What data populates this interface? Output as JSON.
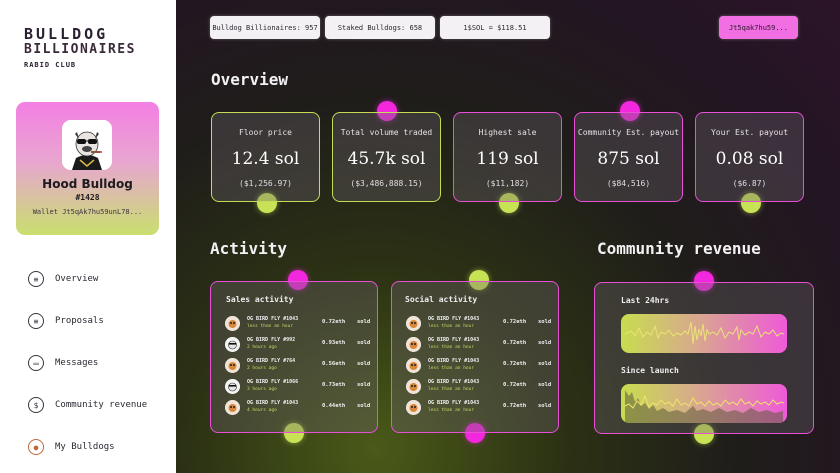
{
  "brand": {
    "line1": "BULLDOG",
    "line2": "BILLIONAIRES",
    "line3": "RABID CLUB"
  },
  "profile": {
    "name": "Hood Bulldog",
    "id": "#1428",
    "wallet": "Wallet Jt5qAk7hu59unL78..."
  },
  "nav": [
    {
      "label": "Overview",
      "icon": "overview-icon",
      "glyph": "≡"
    },
    {
      "label": "Proposals",
      "icon": "proposals-icon",
      "glyph": "≡"
    },
    {
      "label": "Messages",
      "icon": "messages-icon",
      "glyph": "▭"
    },
    {
      "label": "Community revenue",
      "icon": "dollar-icon",
      "glyph": "$"
    },
    {
      "label": "My Bulldogs",
      "icon": "bulldog-icon",
      "glyph": "●"
    }
  ],
  "topbar": {
    "billionaires": "Bulldog Billionaires: 957",
    "staked": "Staked Bulldogs: 658",
    "sol_price": "1$SOL = $118.51",
    "wallet": "Jt5qak7hu59..."
  },
  "overview": {
    "title": "Overview",
    "stats": [
      {
        "label": "Floor price",
        "value": "12.4 sol",
        "usd": "($1,256.97)"
      },
      {
        "label": "Total volume traded",
        "value": "45.7k sol",
        "usd": "($3,486,888.15)"
      },
      {
        "label": "Highest sale",
        "value": "119 sol",
        "usd": "($11,182)"
      },
      {
        "label": "Community Est. payout",
        "value": "875 sol",
        "usd": "($84,516)"
      },
      {
        "label": "Your Est. payout",
        "value": "0.08 sol",
        "usd": "($6.87)"
      }
    ]
  },
  "activity": {
    "title": "Activity",
    "sales": {
      "title": "Sales activity",
      "rows": [
        {
          "name": "OG BIRD FLY #1043",
          "time": "less than an hour",
          "price": "0.72eth",
          "status": "sold"
        },
        {
          "name": "OG BIRD FLY #992",
          "time": "2 hours ago",
          "price": "0.93eth",
          "status": "sold"
        },
        {
          "name": "OG BIRD FLY #764",
          "time": "2 hours ago",
          "price": "0.56eth",
          "status": "sold"
        },
        {
          "name": "OG BIRD FLY #1066",
          "time": "3 hours ago",
          "price": "0.73eth",
          "status": "sold"
        },
        {
          "name": "OG BIRD FLY #1043",
          "time": "4 hours ago",
          "price": "0.44eth",
          "status": "sold"
        }
      ]
    },
    "social": {
      "title": "Social activity",
      "rows": [
        {
          "name": "OG BIRD FLY #1043",
          "time": "less than an hour",
          "price": "0.72eth",
          "status": "sold"
        },
        {
          "name": "OG BIRD FLY #1043",
          "time": "less than an hour",
          "price": "0.72eth",
          "status": "sold"
        },
        {
          "name": "OG BIRD FLY #1043",
          "time": "less than an hour",
          "price": "0.72eth",
          "status": "sold"
        },
        {
          "name": "OG BIRD FLY #1043",
          "time": "less than an hour",
          "price": "0.72eth",
          "status": "sold"
        },
        {
          "name": "OG BIRD FLY #1043",
          "time": "less than an hour",
          "price": "0.72eth",
          "status": "sold"
        }
      ]
    }
  },
  "community_revenue": {
    "title": "Community revenue",
    "last24_label": "Last 24hrs",
    "launch_label": "Since launch"
  },
  "colors": {
    "accent_pink": "#f327de",
    "accent_lime": "#c8e255"
  }
}
